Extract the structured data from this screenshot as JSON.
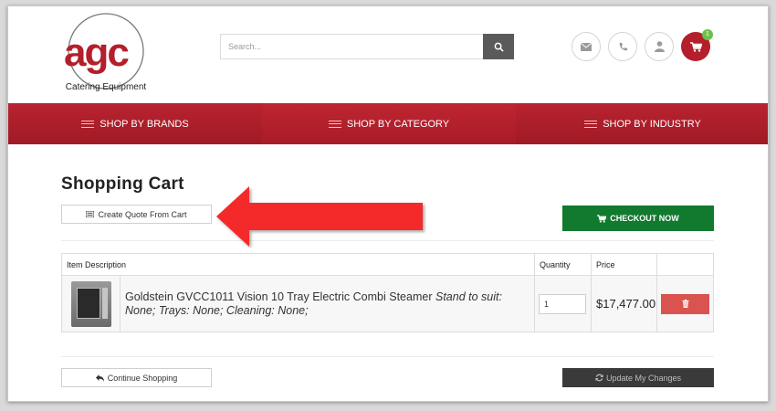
{
  "brand": {
    "logo_text": "agc",
    "logo_subtitle": "Catering Equipment",
    "accent_color": "#b41f2b"
  },
  "header": {
    "search_placeholder": "Search...",
    "search_icon": "search-icon",
    "icons": [
      "envelope-icon",
      "phone-icon",
      "user-icon",
      "cart-icon"
    ],
    "cart_count": "1"
  },
  "nav": {
    "items": [
      {
        "label": "SHOP BY BRANDS"
      },
      {
        "label": "SHOP BY CATEGORY"
      },
      {
        "label": "SHOP BY INDUSTRY"
      }
    ]
  },
  "page": {
    "title": "Shopping Cart",
    "quote_button": "Create Quote From Cart",
    "checkout_button": "CHECKOUT NOW",
    "continue_button": "Continue Shopping",
    "update_button": "Update My Changes",
    "checkout_color": "#127a2f",
    "delete_color": "#d9534f"
  },
  "cart": {
    "columns": [
      "Item Description",
      "Quantity",
      "Price",
      ""
    ],
    "items": [
      {
        "name": "Goldstein GVCC1011 Vision 10 Tray Electric Combi Steamer",
        "options": "Stand to suit: None; Trays: None; Cleaning: None;",
        "quantity": "1",
        "price": "$17,477.00"
      }
    ]
  }
}
